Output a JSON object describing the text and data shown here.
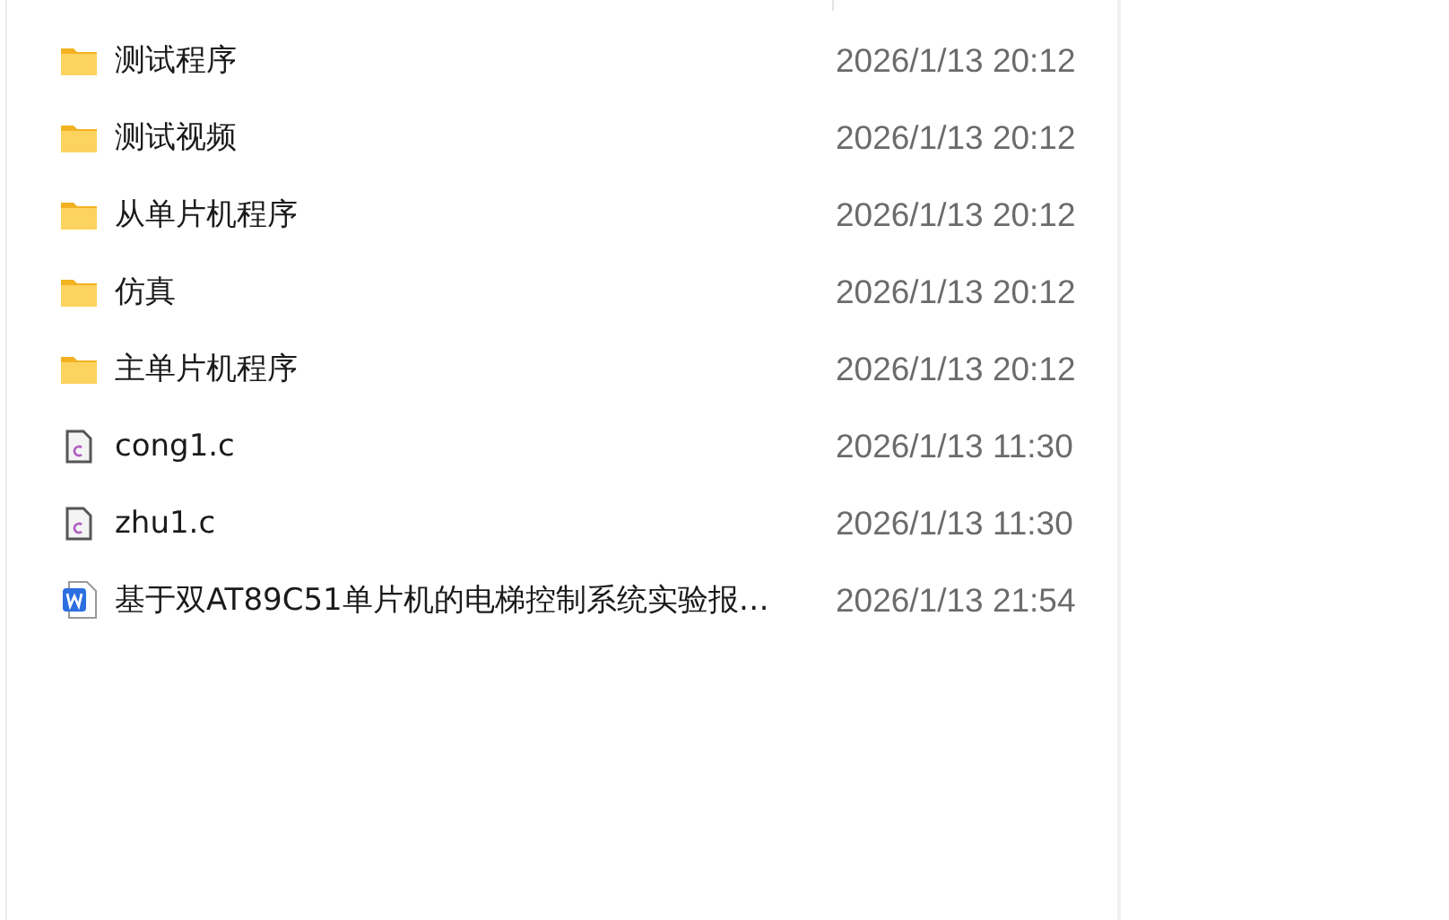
{
  "files": [
    {
      "kind": "folder",
      "name": "测试程序",
      "modified": "2026/1/13 20:12"
    },
    {
      "kind": "folder",
      "name": "测试视频",
      "modified": "2026/1/13 20:12"
    },
    {
      "kind": "folder",
      "name": "从单片机程序",
      "modified": "2026/1/13 20:12"
    },
    {
      "kind": "folder",
      "name": "仿真",
      "modified": "2026/1/13 20:12"
    },
    {
      "kind": "folder",
      "name": "主单片机程序",
      "modified": "2026/1/13 20:12"
    },
    {
      "kind": "c",
      "name": "cong1.c",
      "modified": "2026/1/13 11:30"
    },
    {
      "kind": "c",
      "name": "zhu1.c",
      "modified": "2026/1/13 11:30"
    },
    {
      "kind": "word",
      "name": "基于双AT89C51单片机的电梯控制系统实验报…",
      "modified": "2026/1/13 21:54"
    }
  ]
}
